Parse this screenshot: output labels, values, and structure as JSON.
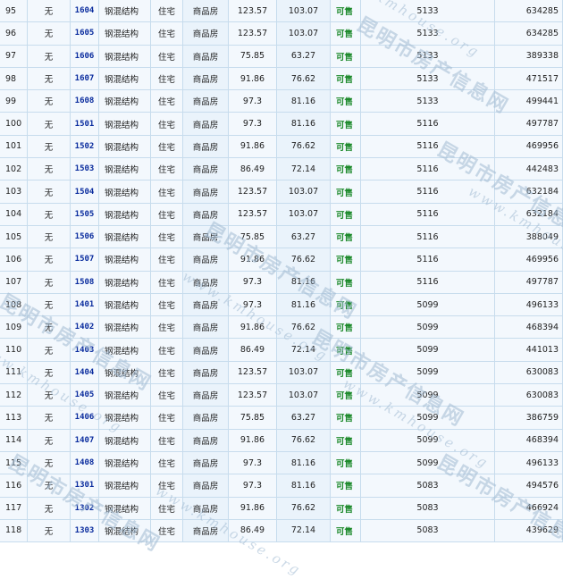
{
  "table": {
    "rows": [
      {
        "seq": "95",
        "mark": "无",
        "room": "1604",
        "structure": "钢混结构",
        "usage": "住宅",
        "type": "商品房",
        "build_area": "123.57",
        "inner_area": "103.07",
        "status": "可售",
        "unit_price": "5133",
        "total": "634285"
      },
      {
        "seq": "96",
        "mark": "无",
        "room": "1605",
        "structure": "钢混结构",
        "usage": "住宅",
        "type": "商品房",
        "build_area": "123.57",
        "inner_area": "103.07",
        "status": "可售",
        "unit_price": "5133",
        "total": "634285"
      },
      {
        "seq": "97",
        "mark": "无",
        "room": "1606",
        "structure": "钢混结构",
        "usage": "住宅",
        "type": "商品房",
        "build_area": "75.85",
        "inner_area": "63.27",
        "status": "可售",
        "unit_price": "5133",
        "total": "389338"
      },
      {
        "seq": "98",
        "mark": "无",
        "room": "1607",
        "structure": "钢混结构",
        "usage": "住宅",
        "type": "商品房",
        "build_area": "91.86",
        "inner_area": "76.62",
        "status": "可售",
        "unit_price": "5133",
        "total": "471517"
      },
      {
        "seq": "99",
        "mark": "无",
        "room": "1608",
        "structure": "钢混结构",
        "usage": "住宅",
        "type": "商品房",
        "build_area": "97.3",
        "inner_area": "81.16",
        "status": "可售",
        "unit_price": "5133",
        "total": "499441"
      },
      {
        "seq": "100",
        "mark": "无",
        "room": "1501",
        "structure": "钢混结构",
        "usage": "住宅",
        "type": "商品房",
        "build_area": "97.3",
        "inner_area": "81.16",
        "status": "可售",
        "unit_price": "5116",
        "total": "497787"
      },
      {
        "seq": "101",
        "mark": "无",
        "room": "1502",
        "structure": "钢混结构",
        "usage": "住宅",
        "type": "商品房",
        "build_area": "91.86",
        "inner_area": "76.62",
        "status": "可售",
        "unit_price": "5116",
        "total": "469956"
      },
      {
        "seq": "102",
        "mark": "无",
        "room": "1503",
        "structure": "钢混结构",
        "usage": "住宅",
        "type": "商品房",
        "build_area": "86.49",
        "inner_area": "72.14",
        "status": "可售",
        "unit_price": "5116",
        "total": "442483"
      },
      {
        "seq": "103",
        "mark": "无",
        "room": "1504",
        "structure": "钢混结构",
        "usage": "住宅",
        "type": "商品房",
        "build_area": "123.57",
        "inner_area": "103.07",
        "status": "可售",
        "unit_price": "5116",
        "total": "632184"
      },
      {
        "seq": "104",
        "mark": "无",
        "room": "1505",
        "structure": "钢混结构",
        "usage": "住宅",
        "type": "商品房",
        "build_area": "123.57",
        "inner_area": "103.07",
        "status": "可售",
        "unit_price": "5116",
        "total": "632184"
      },
      {
        "seq": "105",
        "mark": "无",
        "room": "1506",
        "structure": "钢混结构",
        "usage": "住宅",
        "type": "商品房",
        "build_area": "75.85",
        "inner_area": "63.27",
        "status": "可售",
        "unit_price": "5116",
        "total": "388049"
      },
      {
        "seq": "106",
        "mark": "无",
        "room": "1507",
        "structure": "钢混结构",
        "usage": "住宅",
        "type": "商品房",
        "build_area": "91.86",
        "inner_area": "76.62",
        "status": "可售",
        "unit_price": "5116",
        "total": "469956"
      },
      {
        "seq": "107",
        "mark": "无",
        "room": "1508",
        "structure": "钢混结构",
        "usage": "住宅",
        "type": "商品房",
        "build_area": "97.3",
        "inner_area": "81.16",
        "status": "可售",
        "unit_price": "5116",
        "total": "497787"
      },
      {
        "seq": "108",
        "mark": "无",
        "room": "1401",
        "structure": "钢混结构",
        "usage": "住宅",
        "type": "商品房",
        "build_area": "97.3",
        "inner_area": "81.16",
        "status": "可售",
        "unit_price": "5099",
        "total": "496133"
      },
      {
        "seq": "109",
        "mark": "无",
        "room": "1402",
        "structure": "钢混结构",
        "usage": "住宅",
        "type": "商品房",
        "build_area": "91.86",
        "inner_area": "76.62",
        "status": "可售",
        "unit_price": "5099",
        "total": "468394"
      },
      {
        "seq": "110",
        "mark": "无",
        "room": "1403",
        "structure": "钢混结构",
        "usage": "住宅",
        "type": "商品房",
        "build_area": "86.49",
        "inner_area": "72.14",
        "status": "可售",
        "unit_price": "5099",
        "total": "441013"
      },
      {
        "seq": "111",
        "mark": "无",
        "room": "1404",
        "structure": "钢混结构",
        "usage": "住宅",
        "type": "商品房",
        "build_area": "123.57",
        "inner_area": "103.07",
        "status": "可售",
        "unit_price": "5099",
        "total": "630083"
      },
      {
        "seq": "112",
        "mark": "无",
        "room": "1405",
        "structure": "钢混结构",
        "usage": "住宅",
        "type": "商品房",
        "build_area": "123.57",
        "inner_area": "103.07",
        "status": "可售",
        "unit_price": "5099",
        "total": "630083"
      },
      {
        "seq": "113",
        "mark": "无",
        "room": "1406",
        "structure": "钢混结构",
        "usage": "住宅",
        "type": "商品房",
        "build_area": "75.85",
        "inner_area": "63.27",
        "status": "可售",
        "unit_price": "5099",
        "total": "386759"
      },
      {
        "seq": "114",
        "mark": "无",
        "room": "1407",
        "structure": "钢混结构",
        "usage": "住宅",
        "type": "商品房",
        "build_area": "91.86",
        "inner_area": "76.62",
        "status": "可售",
        "unit_price": "5099",
        "total": "468394"
      },
      {
        "seq": "115",
        "mark": "无",
        "room": "1408",
        "structure": "钢混结构",
        "usage": "住宅",
        "type": "商品房",
        "build_area": "97.3",
        "inner_area": "81.16",
        "status": "可售",
        "unit_price": "5099",
        "total": "496133"
      },
      {
        "seq": "116",
        "mark": "无",
        "room": "1301",
        "structure": "钢混结构",
        "usage": "住宅",
        "type": "商品房",
        "build_area": "97.3",
        "inner_area": "81.16",
        "status": "可售",
        "unit_price": "5083",
        "total": "494576"
      },
      {
        "seq": "117",
        "mark": "无",
        "room": "1302",
        "structure": "钢混结构",
        "usage": "住宅",
        "type": "商品房",
        "build_area": "91.86",
        "inner_area": "76.62",
        "status": "可售",
        "unit_price": "5083",
        "total": "466924"
      },
      {
        "seq": "118",
        "mark": "无",
        "room": "1303",
        "structure": "钢混结构",
        "usage": "住宅",
        "type": "商品房",
        "build_area": "86.49",
        "inner_area": "72.14",
        "status": "可售",
        "unit_price": "5083",
        "total": "439629"
      }
    ]
  },
  "watermark": {
    "cn": "昆明市房产信息网",
    "en": "www.kmhouse.org"
  },
  "colors": {
    "room_link": "#0a2c9e",
    "status_available": "#1e8a2c",
    "grid_line": "#c7dced",
    "cell_bg": "#f3f8fd"
  }
}
